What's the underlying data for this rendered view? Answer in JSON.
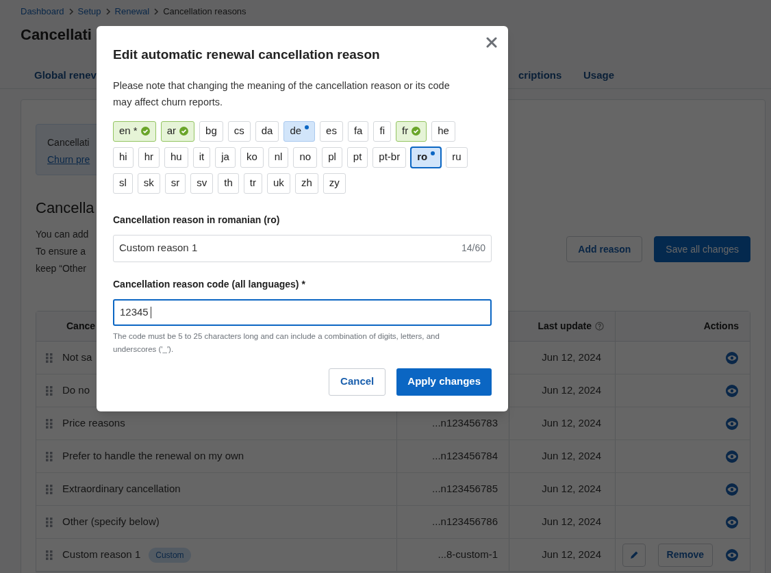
{
  "breadcrumb": {
    "links": [
      "Dashboard",
      "Setup",
      "Renewal"
    ],
    "current": "Cancellation reasons"
  },
  "page_title": "Cancellati",
  "tabs": [
    {
      "label": "Global renev"
    },
    {
      "label": "criptions"
    },
    {
      "label": "Usage"
    }
  ],
  "info_box": {
    "text": "Cancellati",
    "link": "Churn pre"
  },
  "section": {
    "title": "Cancella",
    "lines": [
      "You can add",
      "To ensure a",
      "keep “Other"
    ]
  },
  "buttons": [
    {
      "label": "Add reason",
      "kind": "secondary"
    },
    {
      "label": "Save all changes",
      "kind": "primary"
    }
  ],
  "table": {
    "columns": [
      {
        "label": "Cance"
      },
      {
        "label": "Last update",
        "help": true
      },
      {
        "label": "Actions"
      }
    ],
    "rows": [
      {
        "name": "Not sa",
        "updated": "Jun 12, 2024",
        "actions": [
          {
            "kind": "view"
          }
        ]
      },
      {
        "name": "Do no",
        "updated": "Jun 12, 2024",
        "actions": [
          {
            "kind": "view"
          }
        ]
      },
      {
        "name": "Price reasons",
        "code": "...n123456783",
        "updated": "Jun 12, 2024",
        "actions": [
          {
            "kind": "view"
          }
        ]
      },
      {
        "name": "Prefer to handle the renewal on my own",
        "code": "...n123456784",
        "updated": "Jun 12, 2024",
        "actions": [
          {
            "kind": "view"
          }
        ]
      },
      {
        "name": "Extraordinary cancellation",
        "code": "...n123456785",
        "updated": "Jun 12, 2024",
        "actions": [
          {
            "kind": "view"
          }
        ]
      },
      {
        "name": "Other (specify below)",
        "code": "...n123456786",
        "updated": "Jun 12, 2024",
        "actions": [
          {
            "kind": "view"
          }
        ]
      },
      {
        "name": "Custom reason 1",
        "badge": "Custom",
        "code": "...8-custom-1",
        "updated": "Jun 12, 2024",
        "actions": [
          {
            "kind": "edit"
          },
          {
            "kind": "remove",
            "label": "Remove"
          },
          {
            "kind": "view"
          }
        ]
      }
    ]
  },
  "dialog": {
    "title": "Edit automatic renewal cancellation reason",
    "note": "Please note that changing the meaning of the cancellation reason or its code may affect churn reports.",
    "language_rows": [
      [
        {
          "code": "en *",
          "kind": "done",
          "selected": false
        },
        {
          "code": "ar",
          "kind": "done",
          "selected": false
        },
        {
          "code": "bg",
          "kind": "none",
          "selected": false
        },
        {
          "code": "cs",
          "kind": "none",
          "selected": false
        },
        {
          "code": "da",
          "kind": "none",
          "selected": false
        },
        {
          "code": "de",
          "kind": "edited",
          "selected": false
        },
        {
          "code": "es",
          "kind": "none",
          "selected": false
        },
        {
          "code": "fa",
          "kind": "none",
          "selected": false
        },
        {
          "code": "fi",
          "kind": "none",
          "selected": false
        },
        {
          "code": "fr",
          "kind": "done",
          "selected": false
        },
        {
          "code": "he",
          "kind": "none",
          "selected": false
        }
      ],
      [
        {
          "code": "hi",
          "kind": "none",
          "selected": false
        },
        {
          "code": "hr",
          "kind": "none",
          "selected": false
        },
        {
          "code": "hu",
          "kind": "none",
          "selected": false
        },
        {
          "code": "it",
          "kind": "none",
          "selected": false
        },
        {
          "code": "ja",
          "kind": "none",
          "selected": false
        },
        {
          "code": "ko",
          "kind": "none",
          "selected": false
        },
        {
          "code": "nl",
          "kind": "none",
          "selected": false
        },
        {
          "code": "no",
          "kind": "none",
          "selected": false
        },
        {
          "code": "pl",
          "kind": "none",
          "selected": false
        },
        {
          "code": "pt",
          "kind": "none",
          "selected": false
        },
        {
          "code": "pt-br",
          "kind": "none",
          "selected": false
        },
        {
          "code": "ro",
          "kind": "edited",
          "selected": true
        },
        {
          "code": "ru",
          "kind": "none",
          "selected": false
        }
      ],
      [
        {
          "code": "sl",
          "kind": "none",
          "selected": false
        },
        {
          "code": "sk",
          "kind": "none",
          "selected": false
        },
        {
          "code": "sr",
          "kind": "none",
          "selected": false
        },
        {
          "code": "sv",
          "kind": "none",
          "selected": false
        },
        {
          "code": "th",
          "kind": "none",
          "selected": false
        },
        {
          "code": "tr",
          "kind": "none",
          "selected": false
        },
        {
          "code": "uk",
          "kind": "none",
          "selected": false
        },
        {
          "code": "zh",
          "kind": "none",
          "selected": false
        },
        {
          "code": "zy",
          "kind": "none",
          "selected": false
        }
      ]
    ],
    "reason_label": "Cancellation reason in romanian (ro)",
    "reason_value": "Custom reason 1",
    "reason_counter": "14/60",
    "code_label": "Cancellation reason code (all languages) *",
    "code_value": "12345",
    "code_focused": true,
    "code_hint": "The code must be 5 to 25 characters long and can include a combination of digits, letters, and underscores ('_').",
    "buttons": [
      {
        "label": "Cancel",
        "kind": "secondary"
      },
      {
        "label": "Apply changes",
        "kind": "primary"
      }
    ]
  }
}
